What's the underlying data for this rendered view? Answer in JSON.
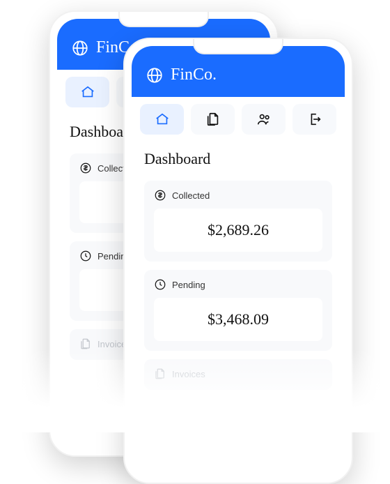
{
  "brand": "FinCo.",
  "nav": {
    "items": [
      {
        "name": "home",
        "active": true
      },
      {
        "name": "documents",
        "active": false
      },
      {
        "name": "users",
        "active": false
      },
      {
        "name": "logout",
        "active": false
      }
    ]
  },
  "page_title": "Dashboard",
  "cards": {
    "collected": {
      "label": "Collected",
      "value": "$2,689.26"
    },
    "pending": {
      "label": "Pending",
      "value": "$3,468.09"
    },
    "invoices": {
      "label": "Invoices"
    }
  },
  "back_phone": {
    "page_title": "Dashboard",
    "collected_label": "Collected",
    "pending_label": "Pending",
    "invoices_label": "Invoices"
  }
}
